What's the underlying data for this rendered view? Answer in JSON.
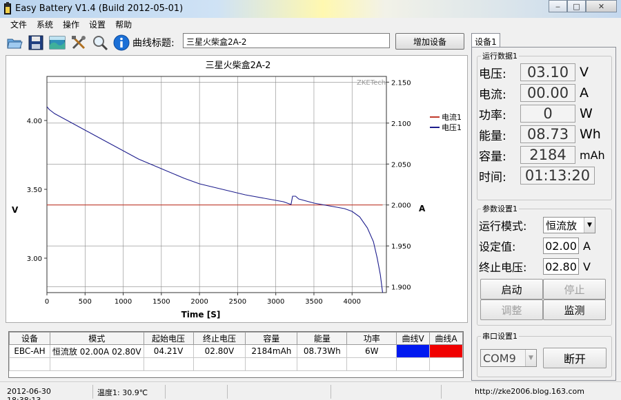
{
  "window": {
    "title": "Easy Battery V1.4 (Build 2012-05-01)",
    "min": "‒",
    "max": "□",
    "close": "✕"
  },
  "menu": [
    "文件",
    "系统",
    "操作",
    "设置",
    "帮助"
  ],
  "toolbar": {
    "curve_label": "曲线标题:",
    "curve_value": "三星火柴盒2A-2",
    "add_device": "增加设备"
  },
  "chart_data": {
    "type": "line",
    "title": "三星火柴盒2A-2",
    "watermark": "ZKETech",
    "xlabel": "Time [S]",
    "ylabel_left": "V",
    "ylabel_right": "A",
    "xlim": [
      0,
      4450
    ],
    "ylim_left": [
      2.75,
      4.32
    ],
    "ylim_right": [
      1.893,
      2.157
    ],
    "x_ticks": [
      0,
      500,
      1000,
      1500,
      2000,
      2500,
      3000,
      3500,
      4000
    ],
    "x_tick_labels": [
      "0",
      "500",
      "1000",
      "1500",
      "2000",
      "2500",
      "3000",
      "3500",
      "4000"
    ],
    "y_left_ticks": [
      3.0,
      3.5,
      4.0
    ],
    "y_left_tick_labels": [
      "3.00",
      "3.50",
      "4.00"
    ],
    "y_right_ticks": [
      1.9,
      1.95,
      2.0,
      2.05,
      2.1,
      2.15
    ],
    "y_right_tick_labels": [
      "1.900",
      "1.950",
      "2.000",
      "2.050",
      "2.100",
      "2.150"
    ],
    "grid": true,
    "legend_placement": "top-right",
    "series": [
      {
        "name": "电流1",
        "axis": "right",
        "color": "#c0392b",
        "x": [
          0,
          4400
        ],
        "y": [
          2.0,
          2.0
        ]
      },
      {
        "name": "电压1",
        "axis": "left",
        "color": "#1c1c8c",
        "x": [
          0,
          30,
          100,
          200,
          400,
          600,
          800,
          1000,
          1200,
          1500,
          1800,
          2000,
          2300,
          2600,
          2900,
          3100,
          3200,
          3220,
          3260,
          3300,
          3500,
          3700,
          3900,
          4000,
          4100,
          4200,
          4280,
          4330,
          4370,
          4400
        ],
        "y": [
          4.1,
          4.08,
          4.05,
          4.02,
          3.96,
          3.9,
          3.84,
          3.78,
          3.72,
          3.65,
          3.58,
          3.54,
          3.5,
          3.46,
          3.43,
          3.41,
          3.39,
          3.45,
          3.45,
          3.43,
          3.4,
          3.38,
          3.36,
          3.34,
          3.3,
          3.22,
          3.12,
          3.0,
          2.88,
          2.75
        ]
      }
    ]
  },
  "table": {
    "headers": [
      "设备",
      "模式",
      "起始电压",
      "终止电压",
      "容量",
      "能量",
      "功率",
      "曲线V",
      "曲线A"
    ],
    "rows": [
      {
        "device": "EBC-AH",
        "mode": "恒流放 02.00A 02.80V",
        "start_v": "04.21V",
        "end_v": "02.80V",
        "capacity": "2184mAh",
        "energy": "08.73Wh",
        "power": "6W",
        "curve_v_color": "#0019f0",
        "curve_a_color": "#f00000"
      }
    ]
  },
  "status": {
    "datetime": "2012-06-30 18:38:13",
    "temp": "温度1: 30.9℃",
    "url": "http://zke2006.blog.163.com"
  },
  "panel": {
    "tab": "设备1",
    "run_group": "运行数据1",
    "voltage_label": "电压:",
    "voltage": "03.10",
    "voltage_unit": "V",
    "current_label": "电流:",
    "current": "00.00",
    "current_unit": "A",
    "power_label": "功率:",
    "power": "0",
    "power_unit": "W",
    "energy_label": "能量:",
    "energy": "08.73",
    "energy_unit": "Wh",
    "capacity_label": "容量:",
    "capacity": "2184",
    "capacity_unit": "mAh",
    "time_label": "时间:",
    "time": "01:13:20",
    "param_group": "参数设置1",
    "mode_label": "运行模式:",
    "mode_value": "恒流放",
    "set_label": "设定值:",
    "set_value": "02.00",
    "set_unit": "A",
    "cutoff_label": "终止电压:",
    "cutoff_value": "02.80",
    "cutoff_unit": "V",
    "start_btn": "启动",
    "stop_btn": "停止",
    "adjust_btn": "调整",
    "monitor_btn": "监测",
    "serial_group": "串口设置1",
    "port_value": "COM9",
    "disconnect_btn": "断开"
  }
}
